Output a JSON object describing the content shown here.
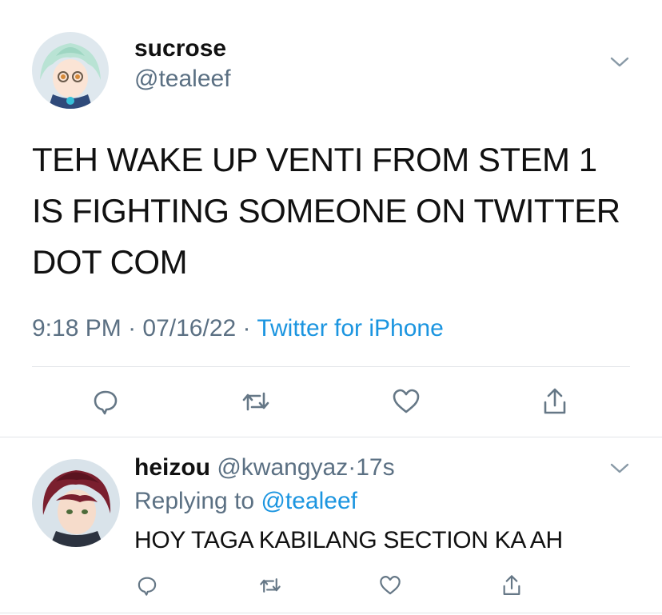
{
  "tweet": {
    "author_name": "sucrose",
    "author_handle": "@tealeef",
    "text_lines": [
      "TEH WAKE UP VENTI FROM STEM 1",
      "IS FIGHTING SOMEONE ON TWITTER",
      "DOT COM"
    ],
    "time": "9:18 PM",
    "date": "07/16/22",
    "sep": "·",
    "source": "Twitter for iPhone"
  },
  "reply": {
    "author_name": "heizou",
    "author_handle": "@kwangyaz",
    "sep": "·",
    "age": "17s",
    "replying_prefix": "Replying to",
    "replying_to": "@tealeef",
    "text": "HOY TAGA KABILANG SECTION KA AH"
  },
  "colors": {
    "text": "#111111",
    "muted": "#5b7083",
    "link": "#1b95e0",
    "divider": "#e1e4e8"
  },
  "icons": [
    "chevron-down-icon",
    "reply-icon",
    "retweet-icon",
    "like-icon",
    "share-icon"
  ]
}
